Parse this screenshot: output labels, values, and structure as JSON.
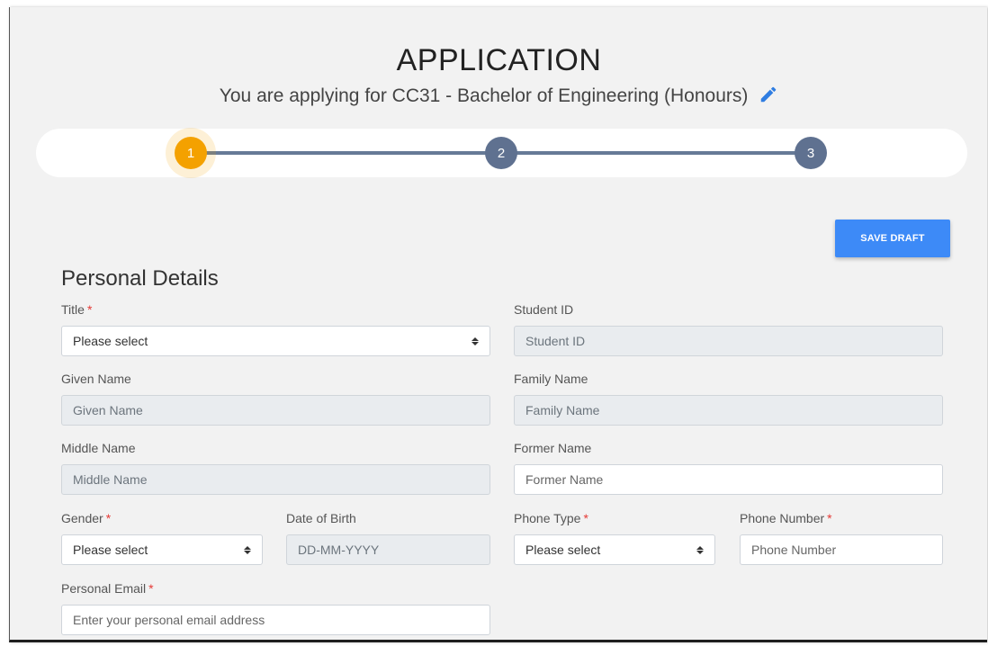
{
  "header": {
    "title": "APPLICATION",
    "subtitle": "You are applying for CC31 - Bachelor of Engineering (Honours)",
    "edit_icon": "pencil-icon"
  },
  "stepper": {
    "steps": [
      "1",
      "2",
      "3"
    ],
    "active_step": 1,
    "colors": {
      "active": "#f4a100",
      "inactive": "#5f7190",
      "line": "#667a97"
    }
  },
  "toolbar": {
    "save_draft_label": "SAVE DRAFT",
    "accent": "#3d8af7"
  },
  "form": {
    "section_title": "Personal Details",
    "title": {
      "label": "Title",
      "value": "Please select"
    },
    "student_id": {
      "label": "Student ID",
      "placeholder": "Student ID"
    },
    "given_name": {
      "label": "Given Name",
      "placeholder": "Given Name"
    },
    "family_name": {
      "label": "Family Name",
      "placeholder": "Family Name"
    },
    "middle_name": {
      "label": "Middle Name",
      "placeholder": "Middle Name"
    },
    "former_name": {
      "label": "Former Name",
      "placeholder": "Former Name"
    },
    "gender": {
      "label": "Gender",
      "value": "Please select"
    },
    "dob": {
      "label": "Date of Birth",
      "placeholder": "DD-MM-YYYY"
    },
    "phone_type": {
      "label": "Phone Type",
      "value": "Please select"
    },
    "phone_number": {
      "label": "Phone Number",
      "placeholder": "Phone Number"
    },
    "personal_email": {
      "label": "Personal Email",
      "placeholder": "Enter your personal email address"
    },
    "required_marker": "*"
  }
}
